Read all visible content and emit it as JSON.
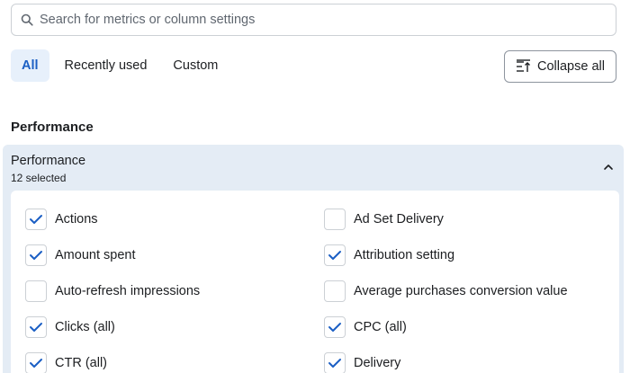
{
  "search": {
    "placeholder": "Search for metrics or column settings"
  },
  "tabs": [
    {
      "label": "All",
      "active": true
    },
    {
      "label": "Recently used",
      "active": false
    },
    {
      "label": "Custom",
      "active": false
    }
  ],
  "collapse_button": {
    "label": "Collapse all"
  },
  "section": {
    "title": "Performance",
    "panel": {
      "title": "Performance",
      "subtitle": "12 selected",
      "options": [
        {
          "label": "Actions",
          "checked": true
        },
        {
          "label": "Ad Set Delivery",
          "checked": false
        },
        {
          "label": "Amount spent",
          "checked": true
        },
        {
          "label": "Attribution setting",
          "checked": true
        },
        {
          "label": "Auto-refresh impressions",
          "checked": false
        },
        {
          "label": "Average purchases conversion value",
          "checked": false
        },
        {
          "label": "Clicks (all)",
          "checked": true
        },
        {
          "label": "CPC (all)",
          "checked": true
        },
        {
          "label": "CTR (all)",
          "checked": true
        },
        {
          "label": "Delivery",
          "checked": true
        }
      ]
    }
  },
  "colors": {
    "accent": "#1b5fc4",
    "panel_bg": "#e4ecf5",
    "active_tab_bg": "#e7f0fb"
  }
}
